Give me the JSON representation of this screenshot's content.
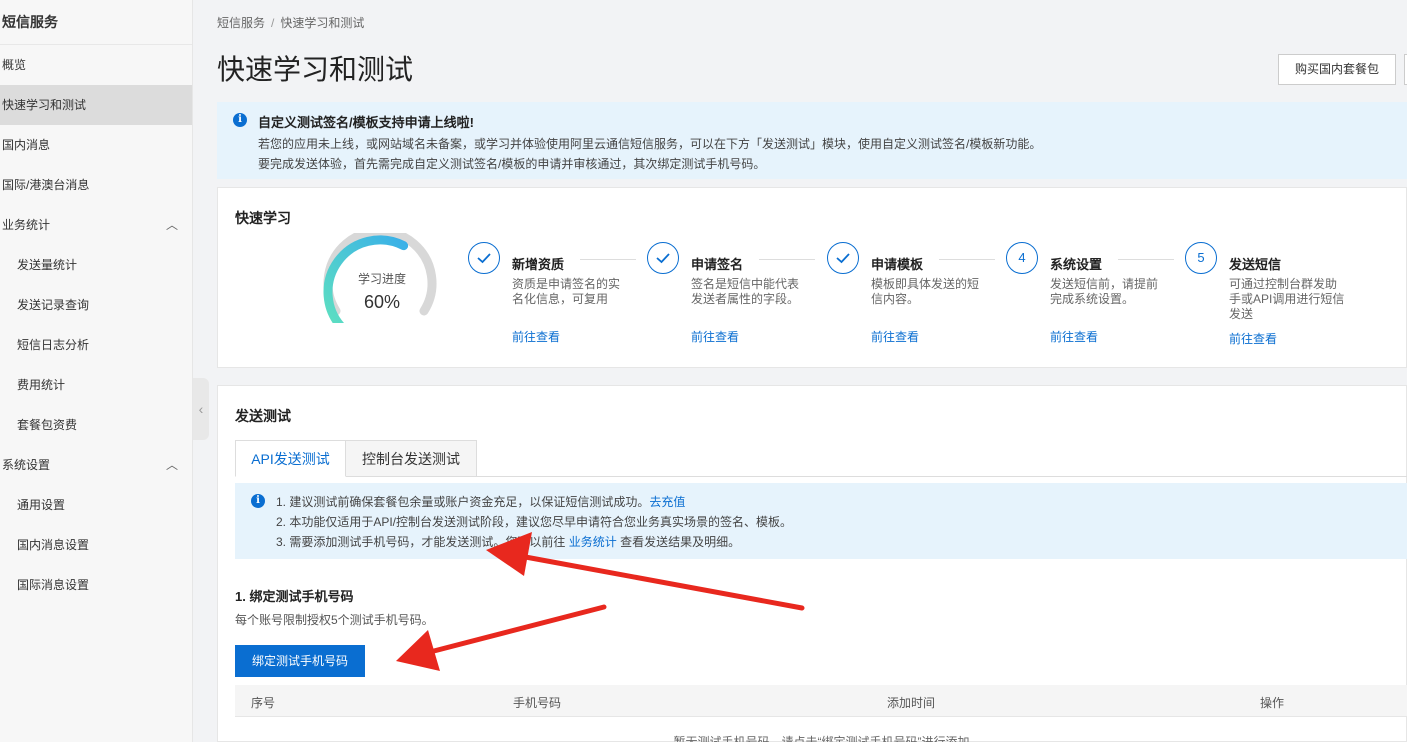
{
  "sidebar": {
    "title": "短信服务",
    "items": [
      {
        "label": "概览",
        "sub": false,
        "active": false
      },
      {
        "label": "快速学习和测试",
        "sub": false,
        "active": true
      },
      {
        "label": "国内消息",
        "sub": false,
        "active": false
      },
      {
        "label": "国际/港澳台消息",
        "sub": false,
        "active": false
      },
      {
        "label": "业务统计",
        "sub": false,
        "active": false,
        "expanded": true
      },
      {
        "label": "发送量统计",
        "sub": true,
        "active": false
      },
      {
        "label": "发送记录查询",
        "sub": true,
        "active": false
      },
      {
        "label": "短信日志分析",
        "sub": true,
        "active": false
      },
      {
        "label": "费用统计",
        "sub": true,
        "active": false
      },
      {
        "label": "套餐包资费",
        "sub": true,
        "active": false
      },
      {
        "label": "系统设置",
        "sub": false,
        "active": false,
        "expanded": true
      },
      {
        "label": "通用设置",
        "sub": true,
        "active": false
      },
      {
        "label": "国内消息设置",
        "sub": true,
        "active": false
      },
      {
        "label": "国际消息设置",
        "sub": true,
        "active": false
      }
    ]
  },
  "breadcrumb": {
    "root": "短信服务",
    "separator": "/",
    "current": "快速学习和测试"
  },
  "page_title": "快速学习和测试",
  "buy_button": "购买国内套餐包",
  "notice": {
    "title": "自定义测试签名/模板支持申请上线啦!",
    "line1": "若您的应用未上线，或网站域名未备案，或学习并体验使用阿里云通信短信服务，可以在下方「发送测试」模块，使用自定义测试签名/模板新功能。",
    "line2": "要完成发送体验，首先需完成自定义测试签名/模板的申请并审核通过，其次绑定测试手机号码。"
  },
  "quick_learn": {
    "title": "快速学习",
    "progress_label": "学习进度",
    "progress_text": "60%",
    "progress": 0.6,
    "steps": [
      {
        "index": "",
        "done": true,
        "name": "新增资质",
        "desc": "资质是申请签名的实名化信息，可复用",
        "link": "前往查看"
      },
      {
        "index": "",
        "done": true,
        "name": "申请签名",
        "desc": "签名是短信中能代表发送者属性的字段。",
        "link": "前往查看"
      },
      {
        "index": "",
        "done": true,
        "name": "申请模板",
        "desc": "模板即具体发送的短信内容。",
        "link": "前往查看"
      },
      {
        "index": "4",
        "done": false,
        "name": "系统设置",
        "desc": "发送短信前，请提前完成系统设置。",
        "link": "前往查看"
      },
      {
        "index": "5",
        "done": false,
        "name": "发送短信",
        "desc": "可通过控制台群发助手或API调用进行短信发送",
        "link": "前往查看"
      }
    ]
  },
  "send_test": {
    "title": "发送测试",
    "tabs": [
      "API发送测试",
      "控制台发送测试"
    ],
    "tip": {
      "line1_text": "1. 建议测试前确保套餐包余量或账户资金充足，以保证短信测试成功。",
      "line1_link": "去充值",
      "line2": "2. 本功能仅适用于API/控制台发送测试阶段，建议您尽早申请符合您业务真实场景的签名、模板。",
      "line3_text": "3. 需要添加测试手机号码，才能发送测试。您可以前往",
      "line3_link": "业务统计",
      "line3_after": "查看发送结果及明细。"
    },
    "section_title": "1. 绑定测试手机号码",
    "section_sub": "每个账号限制授权5个测试手机号码。",
    "bind_button": "绑定测试手机号码",
    "table_headers": [
      "序号",
      "手机号码",
      "添加时间",
      "操作"
    ],
    "empty_text": "暂无测试手机号码，请点击“绑定测试手机号码”进行添加"
  },
  "colors": {
    "accent": "#0a6ed1",
    "arrow": "#e8281e",
    "gauge_start": "#5ee0c0",
    "gauge_end": "#3ab0e8"
  }
}
